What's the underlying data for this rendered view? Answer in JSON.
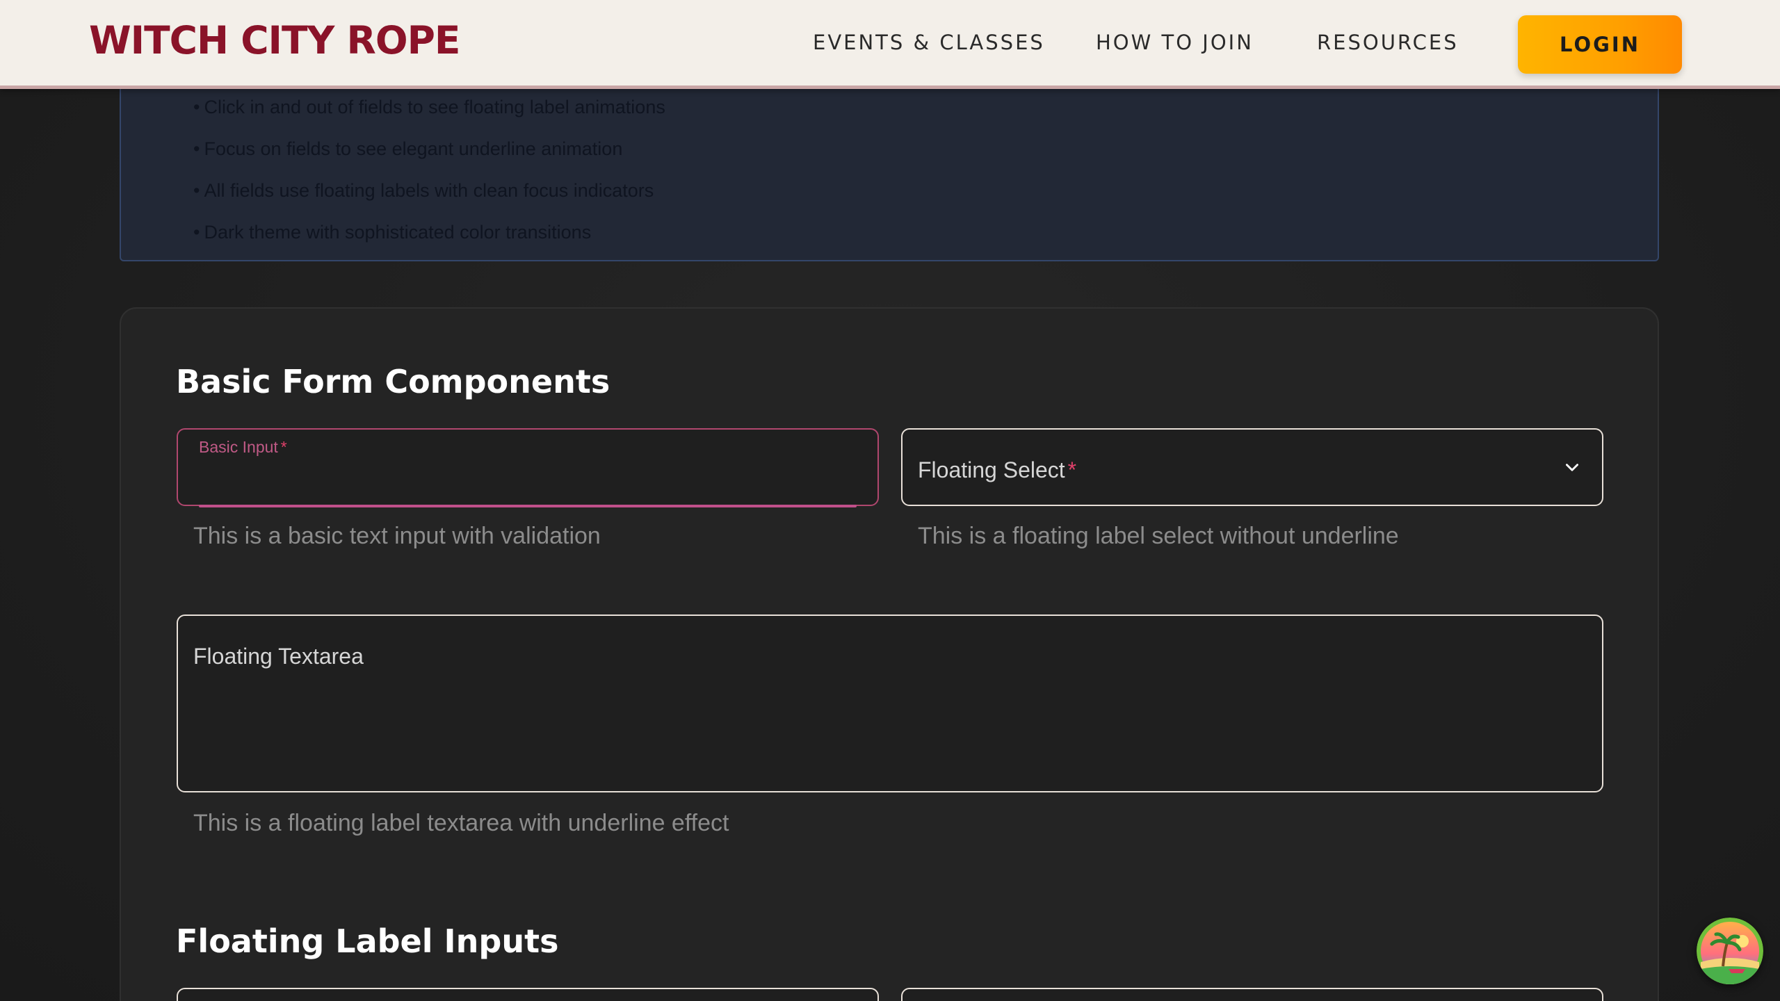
{
  "header": {
    "logo": "WITCH CITY ROPE",
    "nav": {
      "events": "EVENTS & CLASSES",
      "join": "HOW TO JOIN",
      "resources": "RESOURCES"
    },
    "login_label": "LOGIN"
  },
  "info_panel": {
    "items": [
      "Click in and out of fields to see floating label animations",
      "Focus on fields to see elegant underline animation",
      "All fields use floating labels with clean focus indicators",
      "Dark theme with sophisticated color transitions"
    ]
  },
  "basic_section": {
    "title": "Basic Form Components",
    "basic_input": {
      "label": "Basic Input",
      "required_mark": "*",
      "value": "",
      "helper": "This is a basic text input with validation"
    },
    "floating_select": {
      "label": "Floating Select",
      "required_mark": "*",
      "helper": "This is a floating label select without underline"
    },
    "floating_textarea": {
      "label": "Floating Textarea",
      "helper": "This is a floating label textarea with underline effect"
    }
  },
  "floating_section": {
    "title": "Floating Label Inputs"
  },
  "colors": {
    "brand": "#8a1329",
    "accent": "#ffa000",
    "focus": "#c0508a",
    "required": "#e0406a"
  },
  "icons": {
    "select_chevron": "chevron-down-icon",
    "avatar": "beach-avatar-icon"
  }
}
